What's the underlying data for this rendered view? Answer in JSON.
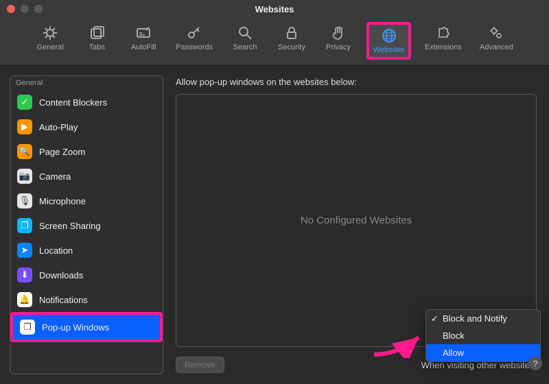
{
  "window": {
    "title": "Websites"
  },
  "toolbar": {
    "items": [
      {
        "label": "General",
        "icon": "gear"
      },
      {
        "label": "Tabs",
        "icon": "tabs"
      },
      {
        "label": "AutoFill",
        "icon": "autofill"
      },
      {
        "label": "Passwords",
        "icon": "key"
      },
      {
        "label": "Search",
        "icon": "search"
      },
      {
        "label": "Security",
        "icon": "lock"
      },
      {
        "label": "Privacy",
        "icon": "hand"
      },
      {
        "label": "Websites",
        "icon": "globe",
        "active": true,
        "highlight": true
      },
      {
        "label": "Extensions",
        "icon": "puzzle"
      },
      {
        "label": "Advanced",
        "icon": "gears"
      }
    ]
  },
  "sidebar": {
    "header": "General",
    "items": [
      {
        "label": "Content Blockers",
        "color": "#2fc84e",
        "glyph": "✓"
      },
      {
        "label": "Auto-Play",
        "color": "#ff9500",
        "glyph": "▶"
      },
      {
        "label": "Page Zoom",
        "color": "#ff9500",
        "glyph": "🔍"
      },
      {
        "label": "Camera",
        "color": "#e5e5e7",
        "glyph": "📷"
      },
      {
        "label": "Microphone",
        "color": "#e5e5e7",
        "glyph": "🎙"
      },
      {
        "label": "Screen Sharing",
        "color": "#0ab6ff",
        "glyph": "❐"
      },
      {
        "label": "Location",
        "color": "#0a84ff",
        "glyph": "➤"
      },
      {
        "label": "Downloads",
        "color": "#7a4dff",
        "glyph": "⬇"
      },
      {
        "label": "Notifications",
        "color": "#ffffff",
        "glyph": "🔔"
      },
      {
        "label": "Pop-up Windows",
        "color": "#ffffff",
        "glyph": "❐",
        "selected": true,
        "highlight": true
      }
    ]
  },
  "main": {
    "heading": "Allow pop-up windows on the websites below:",
    "empty": "No Configured Websites",
    "remove": "Remove",
    "other_label": "When visiting other websites:"
  },
  "dropdown": {
    "items": [
      {
        "label": "Block and Notify",
        "checked": true
      },
      {
        "label": "Block"
      },
      {
        "label": "Allow",
        "selected": true
      }
    ]
  },
  "help": "?"
}
